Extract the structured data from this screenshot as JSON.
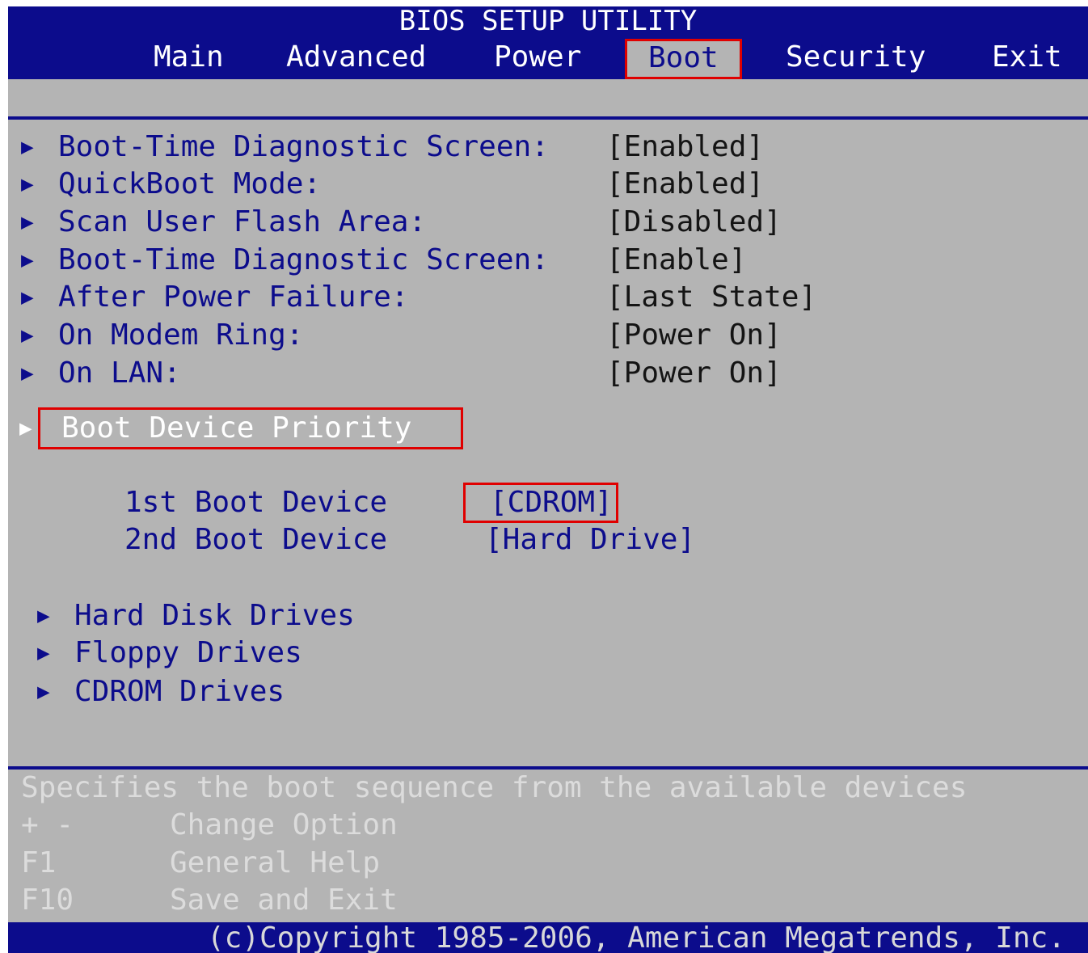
{
  "header": {
    "title": "BIOS SETUP UTILITY",
    "menu": [
      {
        "label": "Main",
        "active": false
      },
      {
        "label": "Advanced",
        "active": false
      },
      {
        "label": "Power",
        "active": false
      },
      {
        "label": "Boot",
        "active": true
      },
      {
        "label": "Security",
        "active": false
      },
      {
        "label": "Exit",
        "active": false
      }
    ]
  },
  "settings": [
    {
      "label": "Boot-Time Diagnostic Screen:",
      "value": "[Enabled]"
    },
    {
      "label": "QuickBoot Mode:",
      "value": "[Enabled]"
    },
    {
      "label": "Scan User Flash Area:",
      "value": "[Disabled]"
    },
    {
      "label": "Boot-Time Diagnostic Screen:",
      "value": "[Enable]"
    },
    {
      "label": "After Power Failure:",
      "value": "[Last State]"
    },
    {
      "label": "On Modem Ring:",
      "value": "[Power On]"
    },
    {
      "label": "On LAN:",
      "value": "[Power On]"
    }
  ],
  "boot_priority": {
    "label": "Boot Device Priority",
    "devices": [
      {
        "label": "1st Boot Device",
        "value": "[CDROM]",
        "selected": true
      },
      {
        "label": "2nd Boot Device",
        "value": "[Hard Drive]",
        "selected": false
      }
    ]
  },
  "drive_menus": [
    {
      "label": "Hard Disk Drives"
    },
    {
      "label": "Floppy Drives"
    },
    {
      "label": "CDROM Drives"
    }
  ],
  "help": {
    "description": "Specifies the boot sequence from the available devices",
    "keys": [
      {
        "key": "+ -",
        "action": "Change Option"
      },
      {
        "key": "F1",
        "action": "General Help"
      },
      {
        "key": "F10",
        "action": "Save and Exit"
      }
    ]
  },
  "footer": {
    "copyright": "(c)Copyright 1985-2006, American Megatrends, Inc."
  },
  "colors": {
    "bios_blue": "#0c0c8c",
    "bios_gray": "#b4b4b4",
    "highlight_red": "#e00000"
  }
}
